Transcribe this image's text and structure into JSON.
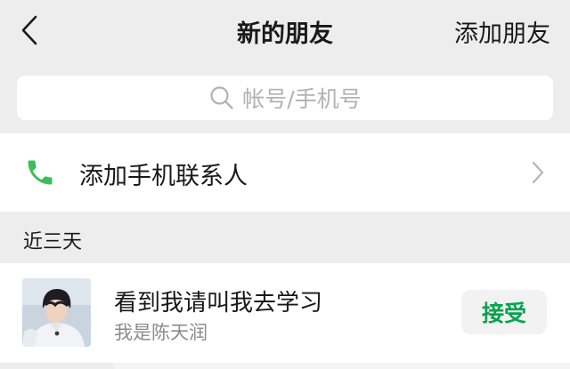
{
  "nav": {
    "back_icon": "chevron-left-icon",
    "title": "新的朋友",
    "action_label": "添加朋友"
  },
  "search": {
    "icon": "search-icon",
    "placeholder": "帐号/手机号"
  },
  "add_contacts": {
    "icon": "phone-icon",
    "label": "添加手机联系人",
    "chevron_icon": "chevron-right-icon"
  },
  "section": {
    "title": "近三天"
  },
  "requests": [
    {
      "name": "看到我请叫我去学习",
      "message": "我是陈天润",
      "accept_label": "接受",
      "avatar": "avatar-photo"
    }
  ],
  "colors": {
    "background": "#ededed",
    "accent_green": "#07a44f",
    "phone_icon_green": "#3dbe5c",
    "muted_text": "#8c8c8c",
    "placeholder_text": "#b2b2b2"
  }
}
